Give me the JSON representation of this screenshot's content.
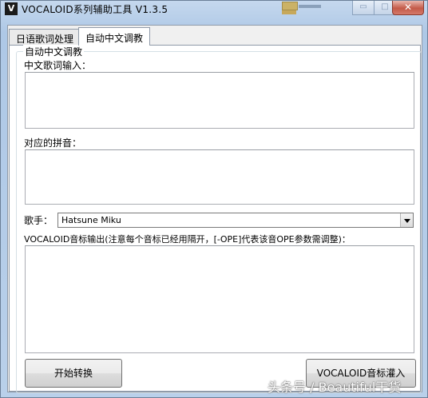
{
  "window": {
    "icon_letter": "V",
    "title": "VOCALOID系列辅助工具  V1.3.5"
  },
  "title_controls": {
    "minimize": "▭",
    "maximize": "□",
    "close": "✕"
  },
  "tabs": [
    {
      "label": "日语歌词处理"
    },
    {
      "label": "自动中文调教"
    }
  ],
  "group": {
    "title": "自动中文调教"
  },
  "labels": {
    "chinese_lyrics": "中文歌词输入：",
    "pinyin": "对应的拼音：",
    "singer": "歌手：",
    "output": "VOCALOID音标输出(注意每个音标已经用隔开，[-OPE]代表该音OPE参数需调整)："
  },
  "fields": {
    "chinese_lyrics": "",
    "pinyin": "",
    "output": ""
  },
  "singer_select": {
    "selected": "Hatsune Miku"
  },
  "buttons": {
    "start": "开始转换",
    "import": "VOCALOID音标灌入"
  },
  "watermark": "头条号 / Beautiful干货"
}
